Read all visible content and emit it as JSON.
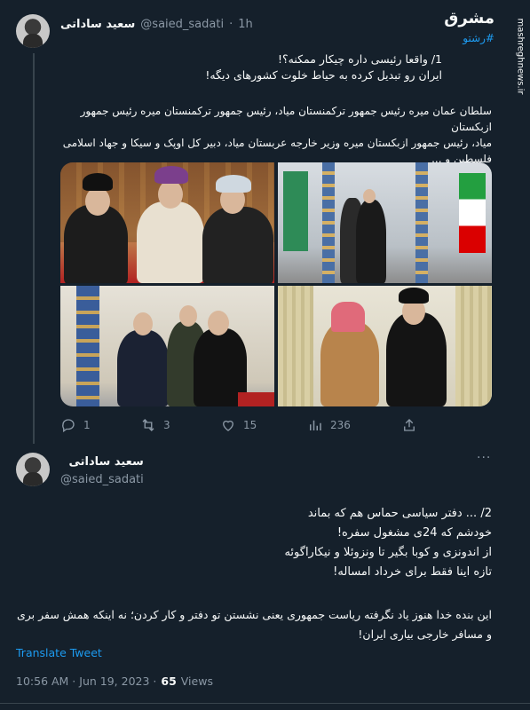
{
  "tweet1": {
    "display_name": "سعید ساداتی",
    "handle": "@saied_sadati",
    "separator": "·",
    "time": "1h",
    "lines_a": [
      "1/ واقعا رئیسی داره چیکار ممکنه؟!",
      "ایران رو تبدیل کرده به حیاط خلوت کشورهای دیگه!"
    ],
    "lines_b": [
      "سلطان عمان میره رئیس جمهور ترکمنستان میاد، رئیس جمهور ترکمنستان میره رئیس جمهور ازبکستان",
      "میاد، رئیس جمهور ازبکستان میره وزیر خارجه عربستان میاد، دبیر کل اوپک و سیکا و جهاد اسلامی",
      "فلسطین و ..."
    ],
    "actions": {
      "replies": "1",
      "retweets": "3",
      "likes": "15",
      "views": "236"
    }
  },
  "tweet2": {
    "display_name": "سعید ساداتی",
    "handle": "@saied_sadati",
    "lines_a": [
      "2/ ... دفتر سیاسی حماس هم که بماند",
      "خودشم که 24ی مشغول سفره!",
      "از اندونزی و کوبا بگیر تا ونزوئلا و نیکاراگوئه",
      "تازه اینا فقط برای خرداد امساله!"
    ],
    "lines_b": [
      "این بنده خدا هنوز یاد نگرفته ریاست جمهوری یعنی نشستن تو دفتر و کار کردن؛ نه اینکه همش سفر بری",
      "و مسافر خارجی بیاری ایران!"
    ],
    "translate_label": "Translate Tweet",
    "timestamp": "10:56 AM · Jun 19, 2023 ·",
    "views_count": "65",
    "views_label": "Views",
    "more_label": "···"
  },
  "watermark": {
    "brand": "مشرق",
    "hashtag": "#رشتو",
    "site": "mashreghnews.ir"
  },
  "colors": {
    "background": "#15202b",
    "text": "#f7f9f9",
    "muted": "#8b98a5",
    "accent": "#1d9bf0"
  }
}
